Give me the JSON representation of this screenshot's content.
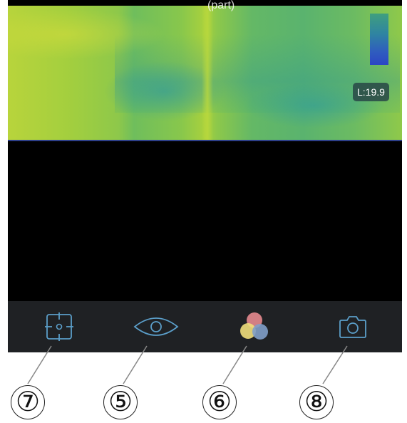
{
  "viewer": {
    "title_fragment": "(part)",
    "low_temp_label": "L:19.9"
  },
  "toolbar": {
    "items": [
      {
        "icon": "crosshair-target-icon",
        "accent": "#5b9ec9"
      },
      {
        "icon": "eye-icon",
        "accent": "#5b9ec9"
      },
      {
        "icon": "color-palette-icon",
        "colors": [
          "#e58a8f",
          "#f0de7c",
          "#7f9fc9"
        ]
      },
      {
        "icon": "camera-icon",
        "accent": "#5b9ec9"
      }
    ]
  },
  "callouts": [
    "⑦",
    "⑤",
    "⑥",
    "⑧"
  ]
}
